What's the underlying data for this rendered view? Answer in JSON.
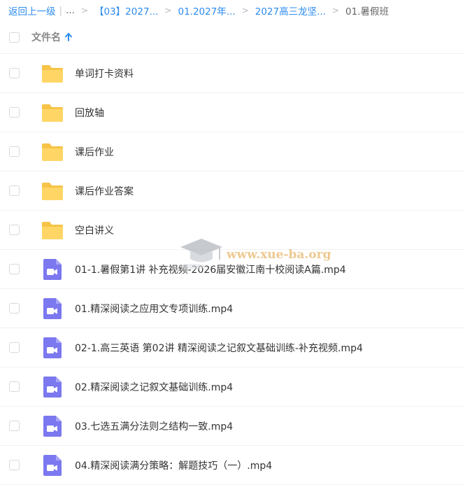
{
  "breadcrumb": {
    "back": "返回上一级",
    "ellipsis": "...",
    "crumbs": [
      "【03】2027...",
      "01.2027年...",
      "2027高三龙坚..."
    ],
    "current": "01.暑假班"
  },
  "header": {
    "column_label": "文件名",
    "sort": "ascending"
  },
  "files": [
    {
      "name": "单词打卡资料",
      "type": "folder"
    },
    {
      "name": "回放轴",
      "type": "folder"
    },
    {
      "name": "课后作业",
      "type": "folder"
    },
    {
      "name": "课后作业答案",
      "type": "folder"
    },
    {
      "name": "空白讲义",
      "type": "folder"
    },
    {
      "name": "01-1.暑假第1讲 补充视频-2026届安徽江南十校阅读A篇.mp4",
      "type": "video"
    },
    {
      "name": "01.精深阅读之应用文专项训练.mp4",
      "type": "video"
    },
    {
      "name": "02-1.高三英语 第02讲 精深阅读之记叙文基础训练-补充视频.mp4",
      "type": "video"
    },
    {
      "name": "02.精深阅读之记叙文基础训练.mp4",
      "type": "video"
    },
    {
      "name": "03.七选五满分法则之结构一致.mp4",
      "type": "video"
    },
    {
      "name": "04.精深阅读满分策略：解题技巧（一）.mp4",
      "type": "video"
    }
  ],
  "watermark": {
    "text": "www.xue-ba.org"
  },
  "colors": {
    "link": "#2d8cf0",
    "folder": "#ffd666",
    "video": "#7b78f0"
  }
}
